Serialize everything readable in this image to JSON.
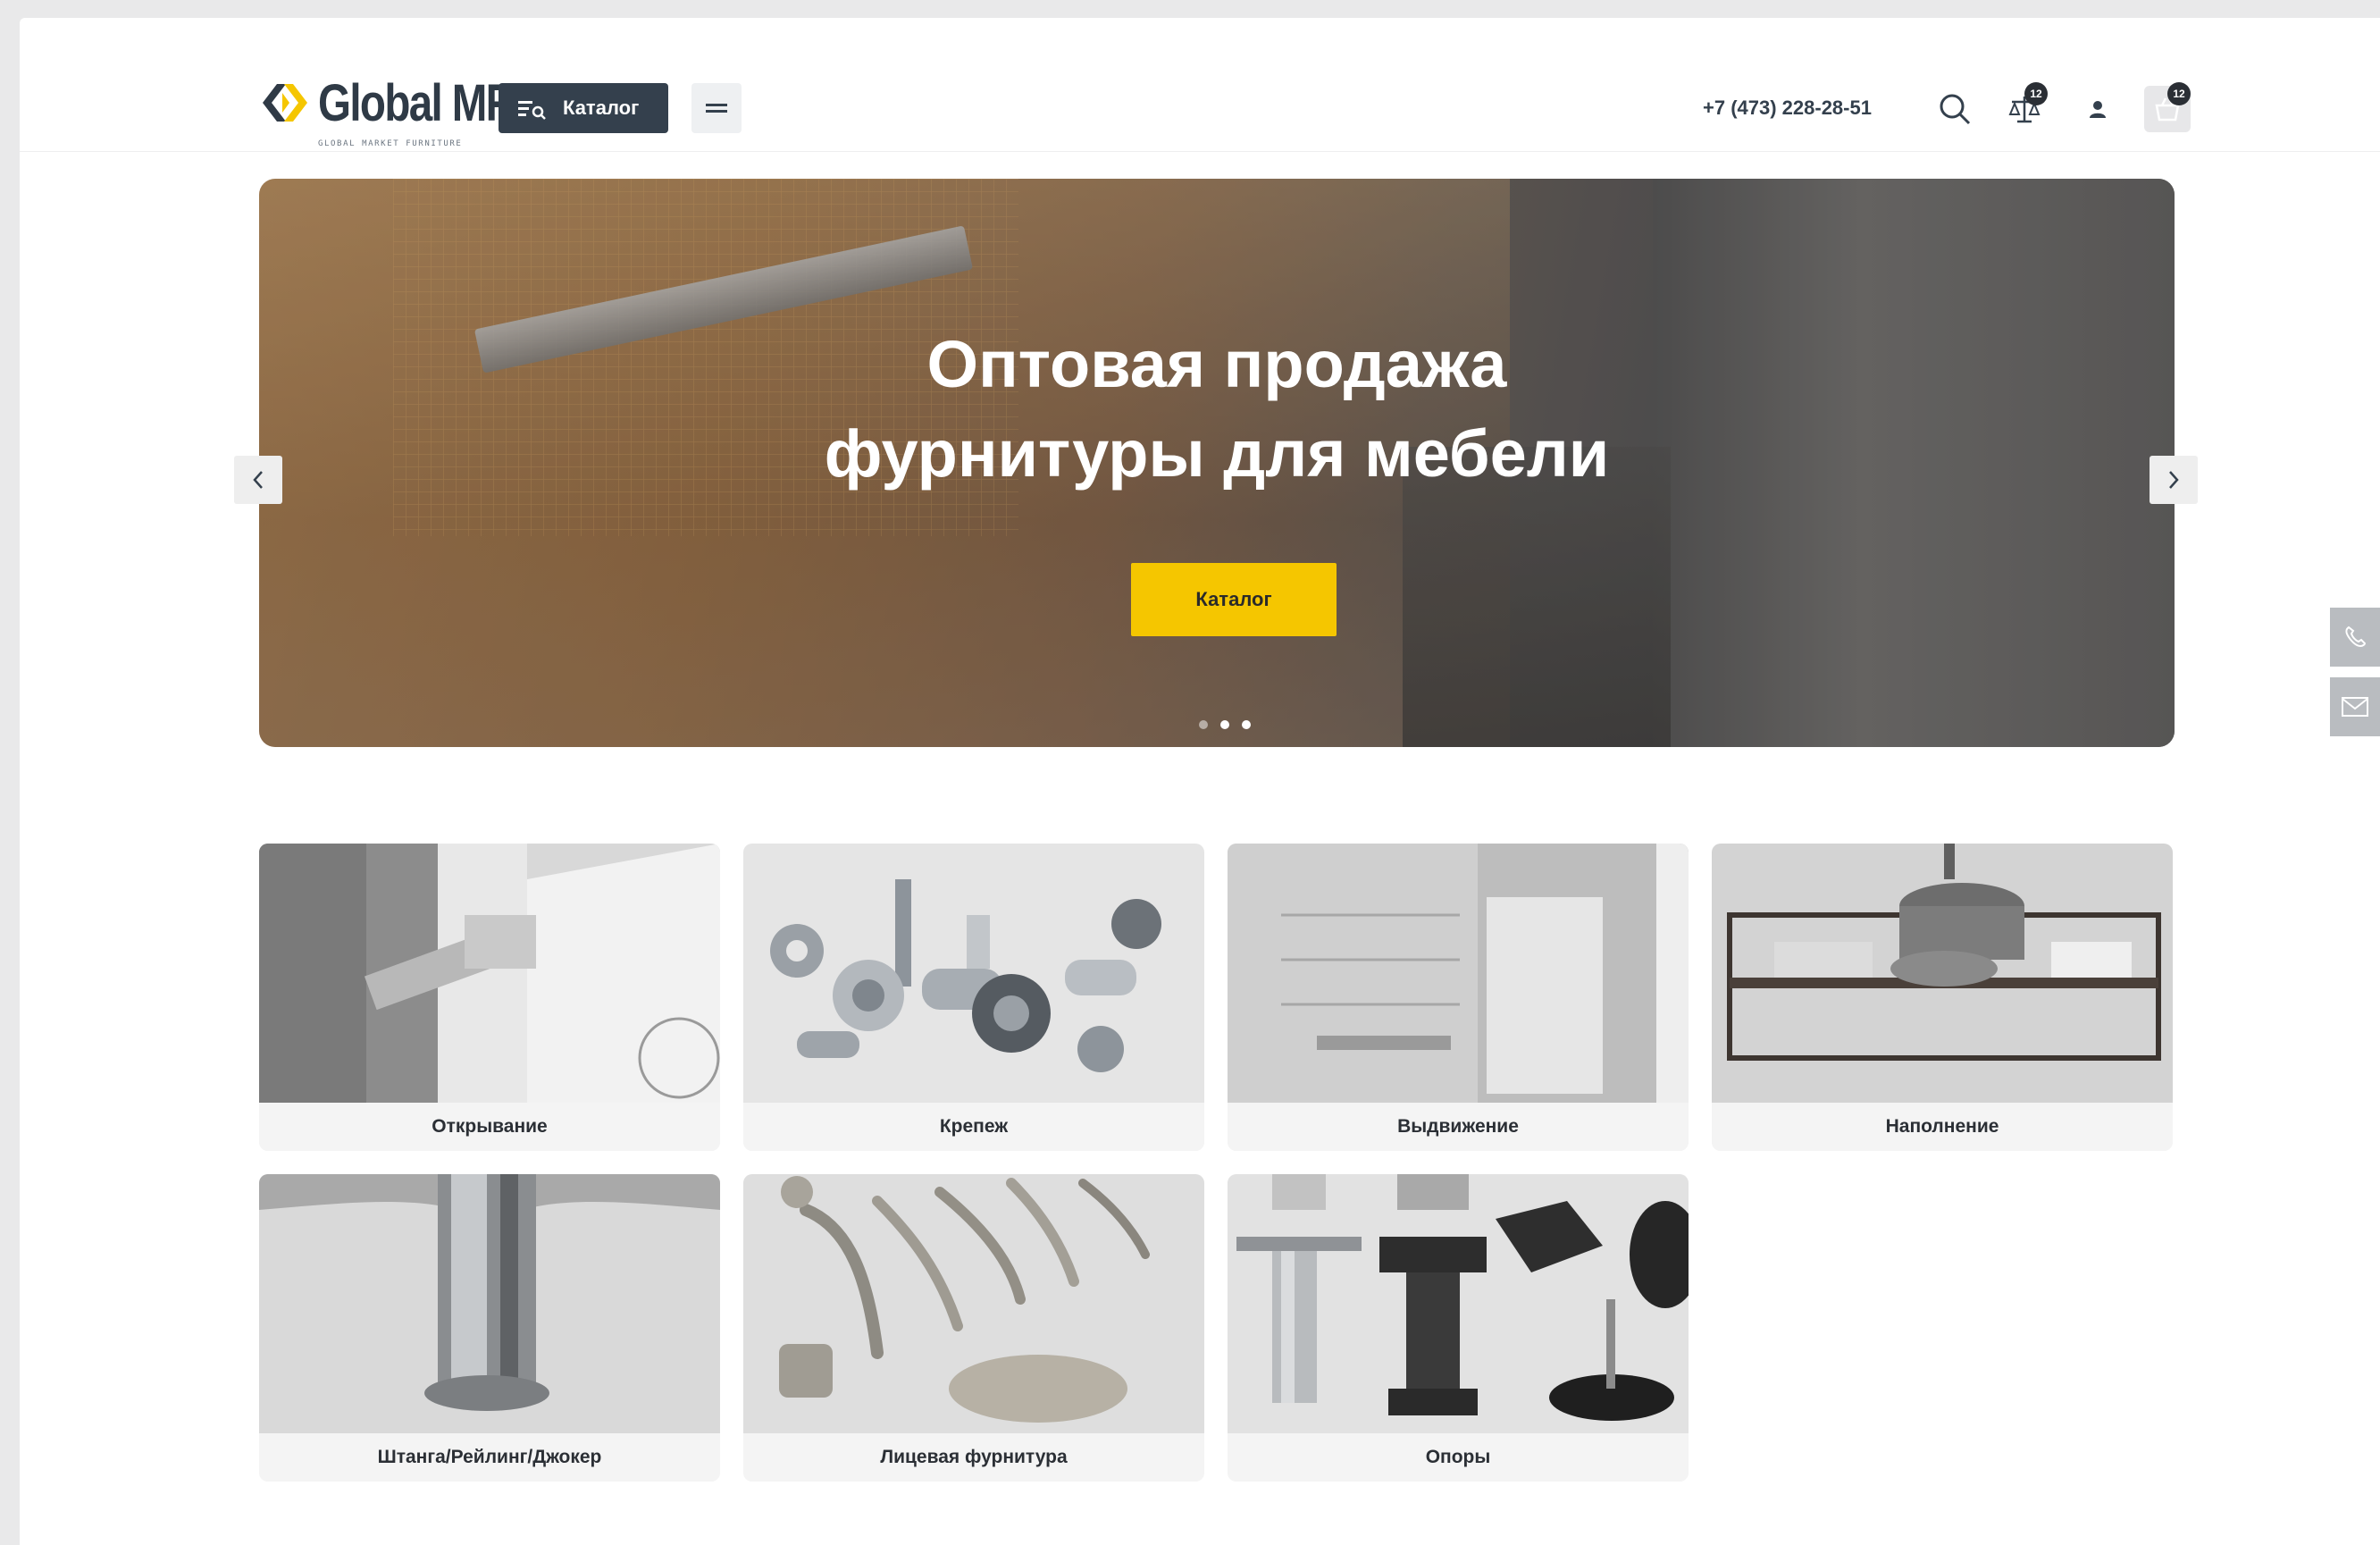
{
  "header": {
    "logo_text": "Global MF",
    "logo_subtitle": "GLOBAL MARKET FURNITURE",
    "catalog_label": "Каталог",
    "phone": "+7 (473) 228-28-51",
    "compare_count": "12",
    "cart_count": "12"
  },
  "hero": {
    "title_line1": "Оптовая продажа",
    "title_line2": "фурнитуры для мебели",
    "button_label": "Каталог",
    "slides_total": 3,
    "active_slide": 2
  },
  "categories": [
    {
      "label": "Открывание"
    },
    {
      "label": "Крепеж"
    },
    {
      "label": "Выдвижение"
    },
    {
      "label": "Наполнение"
    },
    {
      "label": "Штанга/Рейлинг/Джокер"
    },
    {
      "label": "Лицевая фурнитура"
    },
    {
      "label": "Опоры"
    }
  ],
  "colors": {
    "accent_yellow": "#f5c600",
    "dark_navy": "#34404d",
    "badge": "#2b2f35"
  },
  "icons": [
    "catalog-icon",
    "menu-icon",
    "search-icon",
    "compare-icon",
    "user-icon",
    "cart-icon",
    "phone-icon",
    "mail-icon",
    "chevron-left-icon",
    "chevron-right-icon"
  ]
}
